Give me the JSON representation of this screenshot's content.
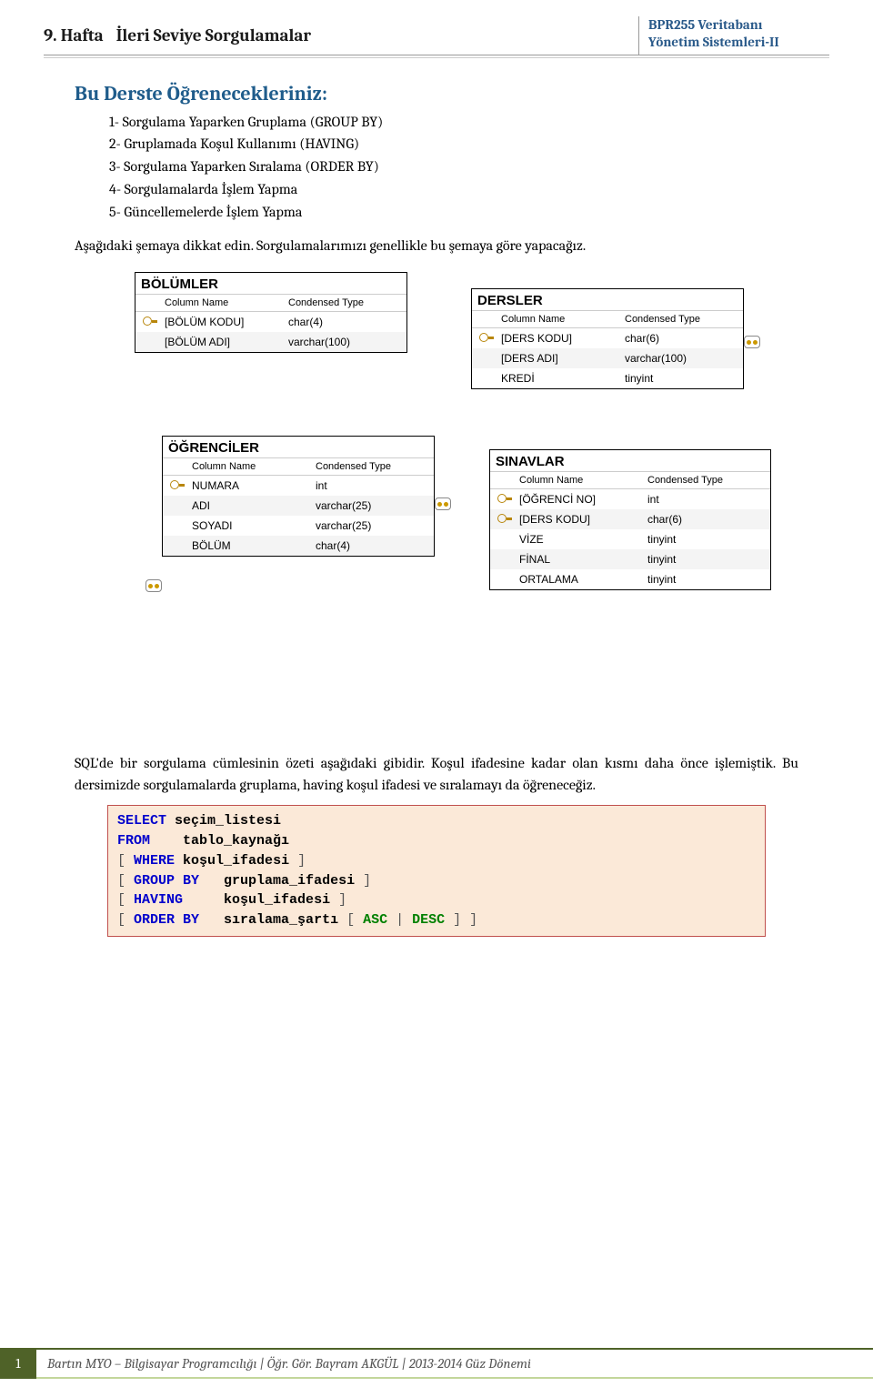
{
  "header": {
    "hafta": "9. Hafta",
    "topic": "İleri Seviye Sorgulamalar",
    "course_line1": "BPR255 Veritabanı",
    "course_line2": "Yönetim Sistemleri-II"
  },
  "section_title": "Bu Derste Öğrenecekleriniz:",
  "learn_items": [
    "Sorgulama Yaparken Gruplama (GROUP BY)",
    "Gruplamada Koşul Kullanımı (HAVING)",
    "Sorgulama Yaparken Sıralama  (ORDER BY)",
    "Sorgulamalarda İşlem Yapma",
    "Güncellemelerde İşlem Yapma"
  ],
  "schema_note": "Aşağıdaki şemaya dikkat edin. Sorgulamalarımızı genellikle bu şemaya göre yapacağız.",
  "tables": {
    "bolumler": {
      "title": "BÖLÜMLER",
      "hd_col": "Column Name",
      "hd_type": "Condensed Type",
      "rows": [
        {
          "pk": true,
          "name": "[BÖLÜM KODU]",
          "type": "char(4)"
        },
        {
          "pk": false,
          "name": "[BÖLÜM ADI]",
          "type": "varchar(100)"
        }
      ]
    },
    "dersler": {
      "title": "DERSLER",
      "hd_col": "Column Name",
      "hd_type": "Condensed Type",
      "rows": [
        {
          "pk": true,
          "name": "[DERS KODU]",
          "type": "char(6)"
        },
        {
          "pk": false,
          "name": "[DERS ADI]",
          "type": "varchar(100)"
        },
        {
          "pk": false,
          "name": "KREDİ",
          "type": "tinyint"
        }
      ]
    },
    "ogrenciler": {
      "title": "ÖĞRENCİLER",
      "hd_col": "Column Name",
      "hd_type": "Condensed Type",
      "rows": [
        {
          "pk": true,
          "name": "NUMARA",
          "type": "int"
        },
        {
          "pk": false,
          "name": "ADI",
          "type": "varchar(25)"
        },
        {
          "pk": false,
          "name": "SOYADI",
          "type": "varchar(25)"
        },
        {
          "pk": false,
          "name": "BÖLÜM",
          "type": "char(4)"
        }
      ]
    },
    "sinavlar": {
      "title": "SINAVLAR",
      "hd_col": "Column Name",
      "hd_type": "Condensed Type",
      "rows": [
        {
          "pk": true,
          "name": "[ÖĞRENCİ NO]",
          "type": "int"
        },
        {
          "pk": true,
          "name": "[DERS KODU]",
          "type": "char(6)"
        },
        {
          "pk": false,
          "name": "VİZE",
          "type": "tinyint"
        },
        {
          "pk": false,
          "name": "FİNAL",
          "type": "tinyint"
        },
        {
          "pk": false,
          "name": "ORTALAMA",
          "type": "tinyint"
        }
      ]
    }
  },
  "paragraph": "SQL'de bir sorgulama cümlesinin özeti aşağıdaki gibidir. Koşul ifadesine kadar olan kısmı daha önce işlemiştik. Bu dersimizde sorgulamalarda gruplama, having koşul ifadesi ve sıralamayı da öğreneceğiz.",
  "sql": {
    "select": "SELECT",
    "select_arg": "seçim_listesi",
    "from": "FROM",
    "from_arg": "tablo_kaynağı",
    "where": "WHERE",
    "where_arg": "koşul_ifadesi",
    "groupby": "GROUP BY",
    "groupby_arg": "gruplama_ifadesi",
    "having": "HAVING",
    "having_arg": "koşul_ifadesi",
    "orderby": "ORDER BY",
    "orderby_arg": "sıralama_şartı",
    "asc": "ASC",
    "desc": "DESC"
  },
  "footer": {
    "page": "1",
    "text": "Bartın MYO – Bilgisayar Programcılığı  |  Öğr. Gör. Bayram AKGÜL | 2013-2014 Güz Dönemi"
  }
}
